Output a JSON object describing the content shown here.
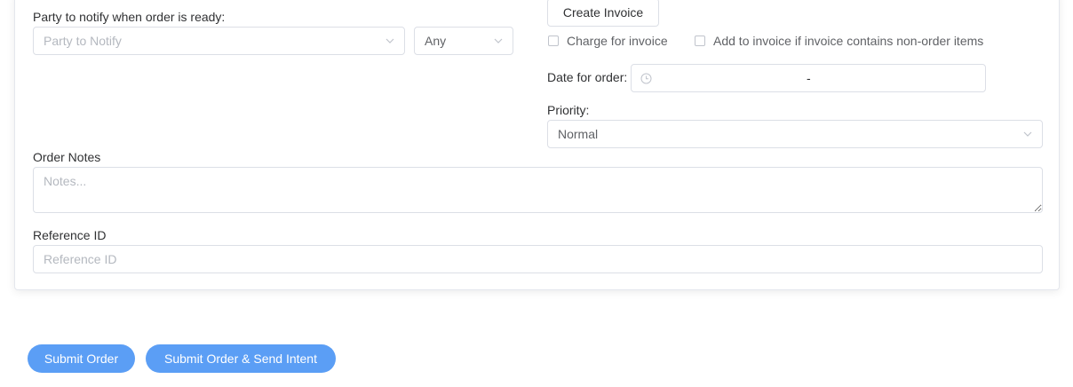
{
  "notify": {
    "label": "Party to notify when order is ready:",
    "party_placeholder": "Party to Notify",
    "scope_value": "Any"
  },
  "invoice": {
    "create_button": "Create Invoice",
    "charge_label": "Charge for invoice",
    "add_label": "Add to invoice if invoice contains non-order items"
  },
  "date": {
    "label": "Date for order:",
    "separator": "-"
  },
  "priority": {
    "label": "Priority:",
    "value": "Normal"
  },
  "notes": {
    "label": "Order Notes",
    "placeholder": "Notes..."
  },
  "reference": {
    "label": "Reference ID",
    "placeholder": "Reference ID"
  },
  "actions": {
    "submit": "Submit Order",
    "submit_send": "Submit Order & Send Intent"
  },
  "colors": {
    "primary": "#5b9ef5",
    "border": "#dcdfe6",
    "placeholder": "#b4b8bf"
  }
}
